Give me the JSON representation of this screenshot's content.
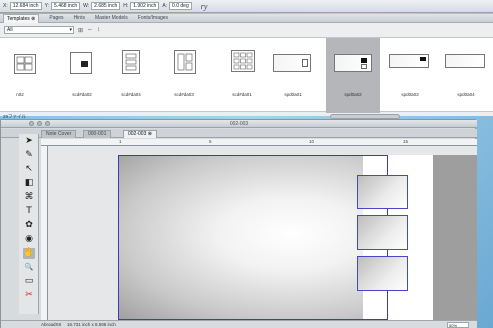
{
  "coord_bar": {
    "fields": [
      {
        "label": "X:",
        "value": "12.684 inch"
      },
      {
        "label": "Y:",
        "value": "5.468 inch"
      },
      {
        "label": "W:",
        "value": "2.685 inch"
      },
      {
        "label": "H:",
        "value": "1.902 inch"
      },
      {
        "label": "A:",
        "value": "0.0 deg"
      }
    ],
    "extra": "ry"
  },
  "templates_panel": {
    "tabs": [
      "Templates ⊗",
      "Pages",
      "Hints",
      "Master Models",
      "Fonts/Images"
    ],
    "filter_value": "All",
    "filter_arrow": "▾",
    "controls": [
      "⊞",
      "⇔",
      "↕"
    ],
    "thumbnails": [
      {
        "caption": "n02",
        "selected": false
      },
      {
        "caption": "scd#da02",
        "selected": false
      },
      {
        "caption": "scd#da04",
        "selected": false
      },
      {
        "caption": "scd#da03",
        "selected": false
      },
      {
        "caption": "scd#da01",
        "selected": false
      },
      {
        "caption": "spd0a01",
        "selected": false
      },
      {
        "caption": "spd0a02",
        "selected": true
      },
      {
        "caption": "spd0a03",
        "selected": false
      },
      {
        "caption": "spd0a04",
        "selected": false
      }
    ],
    "footer_label": "29ファイル"
  },
  "document_window": {
    "title": "002-003",
    "tabs": [
      {
        "label": "Note Cover",
        "active": false
      },
      {
        "label": "000-001",
        "active": false
      },
      {
        "label": "002-003 ⊗",
        "active": true
      }
    ],
    "ruler_numbers": [
      "1",
      "5",
      "10",
      "15"
    ],
    "tools": [
      "➤",
      "✎",
      "↖",
      "◧",
      "⌘",
      "T",
      "✿",
      "◉",
      "✋",
      "🔍",
      "▭",
      "✂"
    ],
    "status": {
      "doc_name": "AbroadX8",
      "page_size": "16.731 inch x 8.596 inch",
      "zoom": "50%"
    }
  }
}
